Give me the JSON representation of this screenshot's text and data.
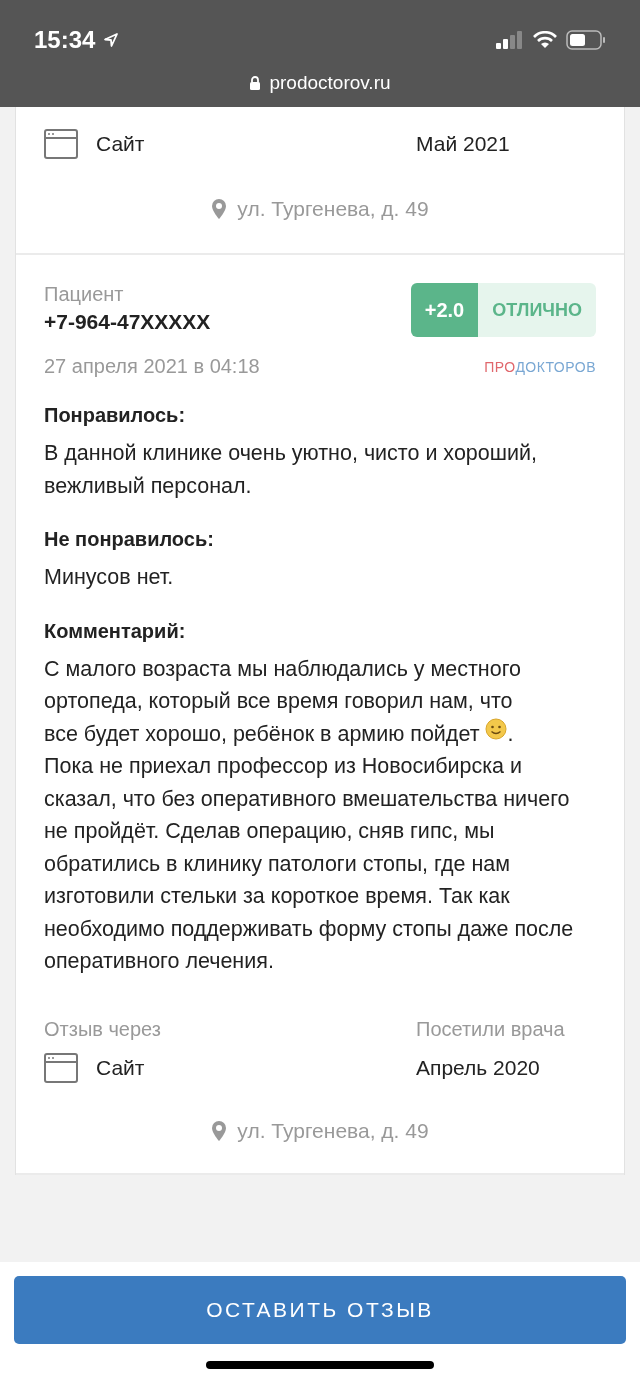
{
  "status_bar": {
    "time": "15:34",
    "url": "prodoctorov.ru"
  },
  "previous_review": {
    "source": "Сайт",
    "visit_date": "Май 2021",
    "address": "ул. Тургенева, д. 49"
  },
  "review": {
    "author_label": "Пациент",
    "author": "+7-964-47XXXXX",
    "score": "+2.0",
    "grade": "ОТЛИЧНО",
    "date": "27 апреля 2021 в 04:18",
    "logo": [
      "ПРО",
      "ДОКТОРОВ"
    ],
    "sections": [
      {
        "heading": "Понравилось:",
        "parts": [
          {
            "kind": "text",
            "text": "В данной клинике очень уютно, чисто и хороший, вежливый персонал."
          }
        ]
      },
      {
        "heading": "Не понравилось:",
        "parts": [
          {
            "kind": "text",
            "text": "Минусов нет."
          }
        ]
      },
      {
        "heading": "Комментарий:",
        "parts": [
          {
            "kind": "text",
            "text": "С малого возраста мы наблюдались у местного ортопеда, который все время говорил нам, что"
          },
          {
            "kind": "line",
            "pieces": [
              {
                "kind": "text",
                "text": "все будет хорошо, ребёнок в армию пойдет"
              },
              {
                "kind": "smiley"
              },
              {
                "kind": "text",
                "text": "."
              }
            ]
          },
          {
            "kind": "text",
            "text": "Пока не приехал профессор из Новосибирска и сказал, что без оперативного вмешательства ничего не пройдёт. Сделав операцию, сняв гипс, мы обратились в клинику патологи стопы, где нам изготовили стельки за короткое время. Так как необходимо поддерживать форму стопы даже после оперативного лечения."
          }
        ]
      }
    ],
    "source_label": "Отзыв через",
    "source": "Сайт",
    "visit_label": "Посетили врача",
    "visit_date": "Апрель 2020",
    "address": "ул. Тургенева, д. 49"
  },
  "button": "ОСТАВИТЬ ОТЗЫВ"
}
